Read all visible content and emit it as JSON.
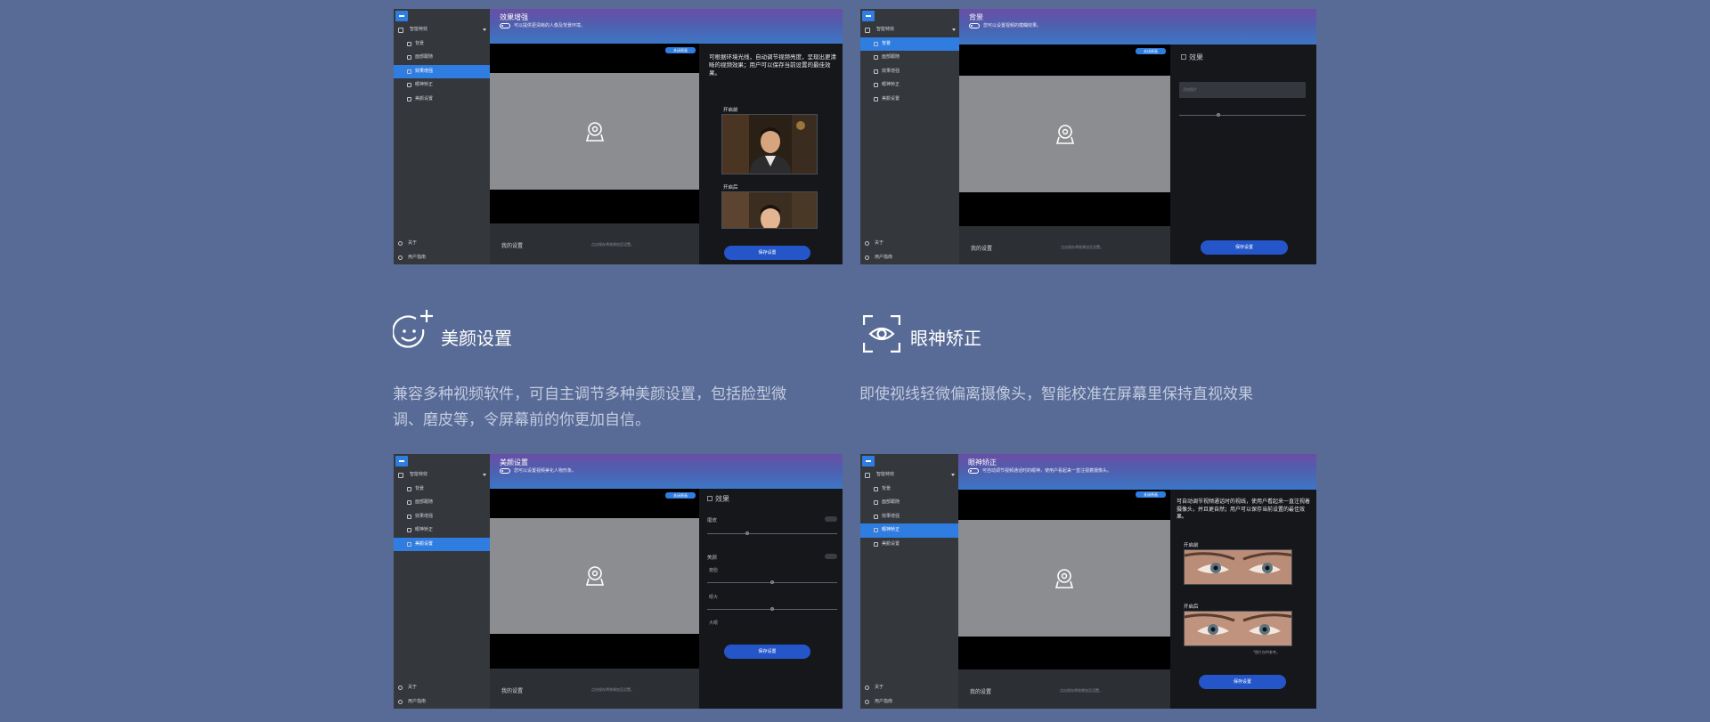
{
  "sidebar": {
    "group": "智能特效",
    "items": [
      "背景",
      "面部跟随",
      "效果增强",
      "眼神矫正",
      "美颜设置"
    ],
    "footer": [
      "关于",
      "用户指南"
    ]
  },
  "common": {
    "pill_label": "关闭原画",
    "my_settings": "我的设置",
    "hint": "点击保存将效果加至设置。",
    "save_label": "保存设置",
    "effects_label": "效果",
    "input_placeholder": "添加图片"
  },
  "screens": {
    "enhance": {
      "title": "效果增强",
      "subtitle": "可以提供更清晰的人像及背景环境。",
      "description": "可根据环境光线，自动调节视频亮度，呈现出更清晰的视频效果；用户可以保存当前设置的最佳效果。",
      "before_label": "开启前",
      "after_label": "开启后"
    },
    "background": {
      "title": "背景",
      "subtitle": "您可以设置视频的模糊效果。"
    },
    "beauty": {
      "title": "美颜设置",
      "subtitle": "您可以设置视频美化人物形象。",
      "sections": [
        "磨皮",
        "美颜"
      ],
      "sub_items": [
        "瘦脸",
        "眼大",
        "大眼"
      ]
    },
    "eye": {
      "title": "眼神矫正",
      "subtitle": "可自动调节视频通话时的眼神，使用户看起来一直注视着摄像头。",
      "description": "可自动调节视频通话时的视线，使用户看起来一直注视着摄像头，并且更自然；用户可以保存当前设置的最佳效果。",
      "before_label": "开启前",
      "after_label": "开启后",
      "footnote": "*图片仅供参考。"
    }
  },
  "features": {
    "beauty": {
      "title": "美颜设置",
      "description_line1": "兼容多种视频软件，可自主调节多种美颜设置，包括脸型微",
      "description_line2": "调、磨皮等，令屏幕前的你更加自信。",
      "icon": "smile-plus-icon"
    },
    "eye": {
      "title": "眼神矫正",
      "description_line1": "即使视线轻微偏离摄像头，智能校准在屏幕里保持直视效果",
      "icon": "eye-scan-icon"
    }
  },
  "colors": {
    "page_bg": "#586b96",
    "accent": "#2f7de1",
    "save_button": "#2456c9"
  }
}
